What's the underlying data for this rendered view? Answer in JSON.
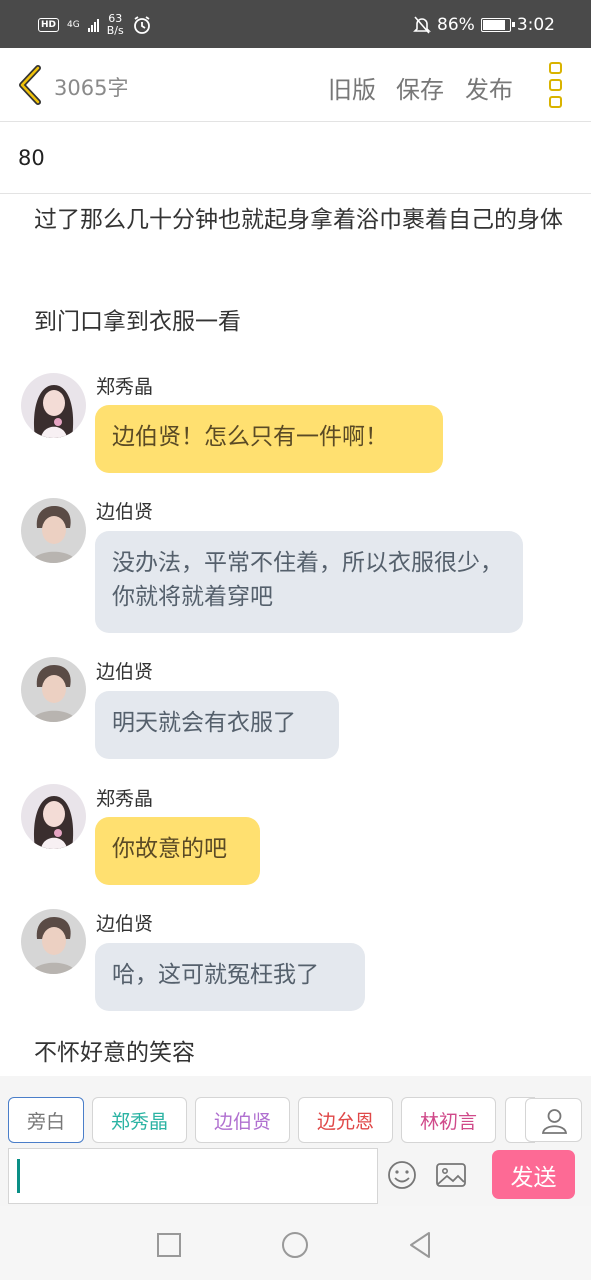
{
  "status_bar": {
    "hd": "HD",
    "network": "4G",
    "speed_value": "63",
    "speed_unit": "B/s",
    "battery": "86%",
    "time": "3:02"
  },
  "header": {
    "word_count": "3065字",
    "old_version": "旧版",
    "save": "保存",
    "publish": "发布"
  },
  "chapter": {
    "number": "80"
  },
  "content": [
    {
      "type": "narration",
      "text": "过了那么几十分钟也就起身拿着浴巾裹着自己的身体"
    },
    {
      "type": "narration",
      "text": "到门口拿到衣服一看"
    },
    {
      "type": "dialogue",
      "speaker": "郑秀晶",
      "text": "边伯贤！怎么只有一件啊！"
    },
    {
      "type": "dialogue",
      "speaker": "边伯贤",
      "text": "没办法，平常不住着，所以衣服很少，你就将就着穿吧"
    },
    {
      "type": "dialogue",
      "speaker": "边伯贤",
      "text": "明天就会有衣服了"
    },
    {
      "type": "dialogue",
      "speaker": "郑秀晶",
      "text": "你故意的吧"
    },
    {
      "type": "dialogue",
      "speaker": "边伯贤",
      "text": "哈，这可就冤枉我了"
    },
    {
      "type": "narration",
      "text": "不怀好意的笑容"
    }
  ],
  "roles": [
    {
      "label": "旁白",
      "color": "#777777"
    },
    {
      "label": "郑秀晶",
      "color": "#2bb3a3"
    },
    {
      "label": "边伯贤",
      "color": "#b070d0"
    },
    {
      "label": "边允恩",
      "color": "#e04848"
    },
    {
      "label": "林初言",
      "color": "#d04a8a"
    }
  ],
  "input": {
    "send_label": "发送"
  },
  "colors": {
    "accent_yellow": "#ffe070",
    "bubble_gray": "#e4e8ee",
    "send_pink": "#fd6a95",
    "menu_gold": "#d9b300"
  },
  "icons": [
    "back-chevron-icon",
    "more-menu-icon",
    "person-icon",
    "emoji-icon",
    "image-icon",
    "nav-square-icon",
    "nav-circle-icon",
    "nav-back-icon"
  ]
}
